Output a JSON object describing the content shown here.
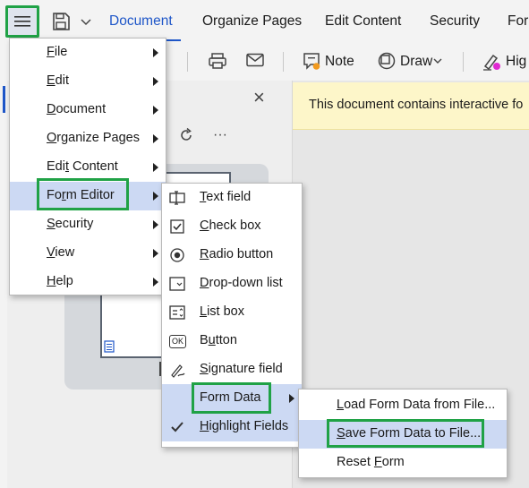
{
  "colors": {
    "accent": "#1e56c8",
    "highlight_box": "#20a246",
    "menu_hover": "#ccd9f3",
    "banner": "#fdf6c9"
  },
  "tabbar": {
    "menu_icon": "hamburger-icon",
    "save_icon": "save-icon",
    "tabs": [
      "Document",
      "Organize Pages",
      "Edit Content",
      "Security",
      "Forr"
    ]
  },
  "toolbar": {
    "print_icon": "printer-icon",
    "mail_icon": "mail-icon",
    "note_label": "Note",
    "draw_label": "Draw",
    "highlight_label": "Hig"
  },
  "thumbnails": {
    "rotate_icon": "rotate-icon",
    "more_label": "···",
    "close_label": "×"
  },
  "banner": {
    "text": "This document contains interactive fo"
  },
  "main_menu": {
    "items": [
      {
        "before": "",
        "u": "F",
        "after": "ile"
      },
      {
        "before": "",
        "u": "E",
        "after": "dit"
      },
      {
        "before": "",
        "u": "D",
        "after": "ocument"
      },
      {
        "before": "",
        "u": "O",
        "after": "rganize Pages"
      },
      {
        "before": "Edi",
        "u": "t",
        "after": " Content"
      },
      {
        "before": "Fo",
        "u": "r",
        "after": "m Editor"
      },
      {
        "before": "",
        "u": "S",
        "after": "ecurity"
      },
      {
        "before": "",
        "u": "V",
        "after": "iew"
      },
      {
        "before": "",
        "u": "H",
        "after": "elp"
      }
    ]
  },
  "form_editor_menu": {
    "items": [
      {
        "before": "",
        "u": "T",
        "after": "ext field",
        "icon": "text-field-icon"
      },
      {
        "before": "",
        "u": "C",
        "after": "heck box",
        "icon": "checkbox-icon"
      },
      {
        "before": "",
        "u": "R",
        "after": "adio button",
        "icon": "radio-button-icon"
      },
      {
        "before": "",
        "u": "D",
        "after": "rop-down list",
        "icon": "dropdown-list-icon"
      },
      {
        "before": "",
        "u": "L",
        "after": "ist box",
        "icon": "list-box-icon"
      },
      {
        "before": "B",
        "u": "u",
        "after": "tton",
        "icon": "ok-button-icon"
      },
      {
        "before": "",
        "u": "S",
        "after": "ignature field",
        "icon": "signature-icon"
      },
      {
        "before": "Form Data",
        "u": "",
        "after": "",
        "icon": ""
      },
      {
        "before": "",
        "u": "H",
        "after": "ighlight Fields",
        "icon": "checkmark-icon"
      }
    ],
    "ok_icon_text": "OK"
  },
  "form_data_menu": {
    "items": [
      {
        "before": "",
        "u": "L",
        "after": "oad Form Data from File..."
      },
      {
        "before": "",
        "u": "S",
        "after": "ave Form Data to File..."
      },
      {
        "before": "Reset ",
        "u": "F",
        "after": "orm"
      }
    ]
  }
}
